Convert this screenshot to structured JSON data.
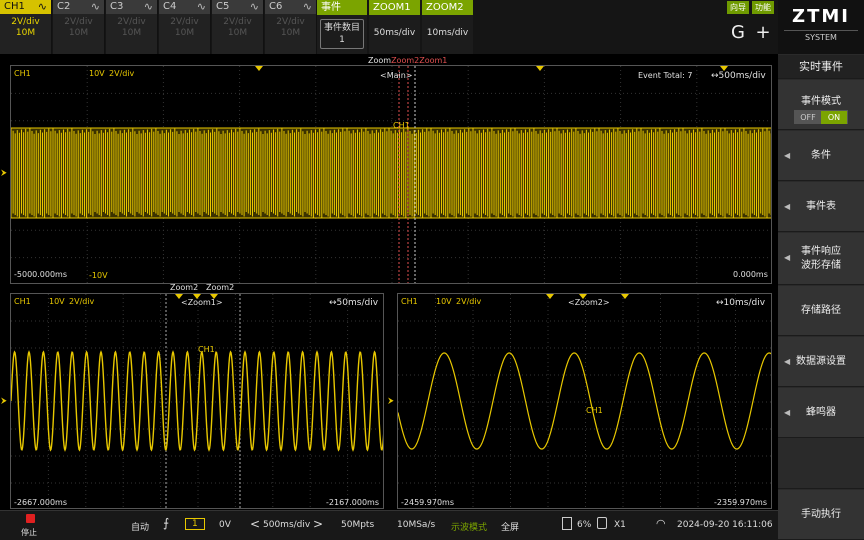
{
  "channels": [
    {
      "name": "CH1",
      "scale": "2V/div",
      "depth": "10M"
    },
    {
      "name": "C2",
      "scale": "2V/div",
      "depth": "10M"
    },
    {
      "name": "C3",
      "scale": "2V/div",
      "depth": "10M"
    },
    {
      "name": "C4",
      "scale": "2V/div",
      "depth": "10M"
    },
    {
      "name": "C5",
      "scale": "2V/div",
      "depth": "10M"
    },
    {
      "name": "C6",
      "scale": "2V/div",
      "depth": "10M"
    }
  ],
  "menu": {
    "event_tab": "事件",
    "event_count_label": "事件数目",
    "event_count_value": "1",
    "zoom1_tab": "ZOOM1",
    "zoom1_timebase": "50ms/div",
    "zoom2_tab": "ZOOM2",
    "zoom2_timebase": "10ms/div"
  },
  "top_right": {
    "guide": "向导",
    "function": "功能",
    "g_icon": "G",
    "plus_icon": "+"
  },
  "logo": {
    "brand": "ZTMI",
    "sub": "SYSTEM"
  },
  "right_panel": {
    "title": "实时事件",
    "event_mode": "事件模式",
    "toggle_off": "OFF",
    "toggle_on": "ON",
    "items": [
      "条件",
      "事件表",
      "事件响应",
      "波形存储",
      "存储路径",
      "数据源设置",
      "蜂鸣器",
      "手动执行"
    ]
  },
  "main_plot": {
    "ch": "CH1",
    "volts": "10V",
    "scale": "2V/div",
    "title": "<Main>",
    "zoom_marks": "Zoom2Zoom1",
    "zoom_prefix": "Zoom",
    "event_total": "Event Total: 7",
    "timebase": "↔500ms/div",
    "left_time": "-5000.000ms",
    "right_time": "0.000ms",
    "bottom_volt": "-10V",
    "wave_label": "CH1"
  },
  "zoom1_plot": {
    "ch": "CH1",
    "volts": "10V",
    "scale": "2V/div",
    "title": "<Zoom1>",
    "top_marks": [
      "Zoom2",
      "Zoom2"
    ],
    "timebase": "↔50ms/div",
    "left_time": "-2667.000ms",
    "right_time": "-2167.000ms",
    "wave_label": "CH1"
  },
  "zoom2_plot": {
    "ch": "CH1",
    "volts": "10V",
    "scale": "2V/div",
    "title": "<Zoom2>",
    "timebase": "↔10ms/div",
    "left_time": "-2459.970ms",
    "right_time": "-2359.970ms",
    "wave_label": "CH1"
  },
  "bottom": {
    "stop": "停止",
    "trigger_mode": "自动",
    "trigger_source": "1",
    "trigger_level": "0V",
    "timebase": "500ms/div",
    "mem_depth": "50Mpts",
    "sample_rate": "10MSa/s",
    "display_mode": "示波模式",
    "fullscreen": "全屏",
    "storage_percent": "6%",
    "probe": "X1",
    "datetime": "2024-09-20 16:11:06"
  },
  "colors": {
    "trace": "#e8c800",
    "accent": "#7ba400",
    "stop": "#e02020"
  }
}
